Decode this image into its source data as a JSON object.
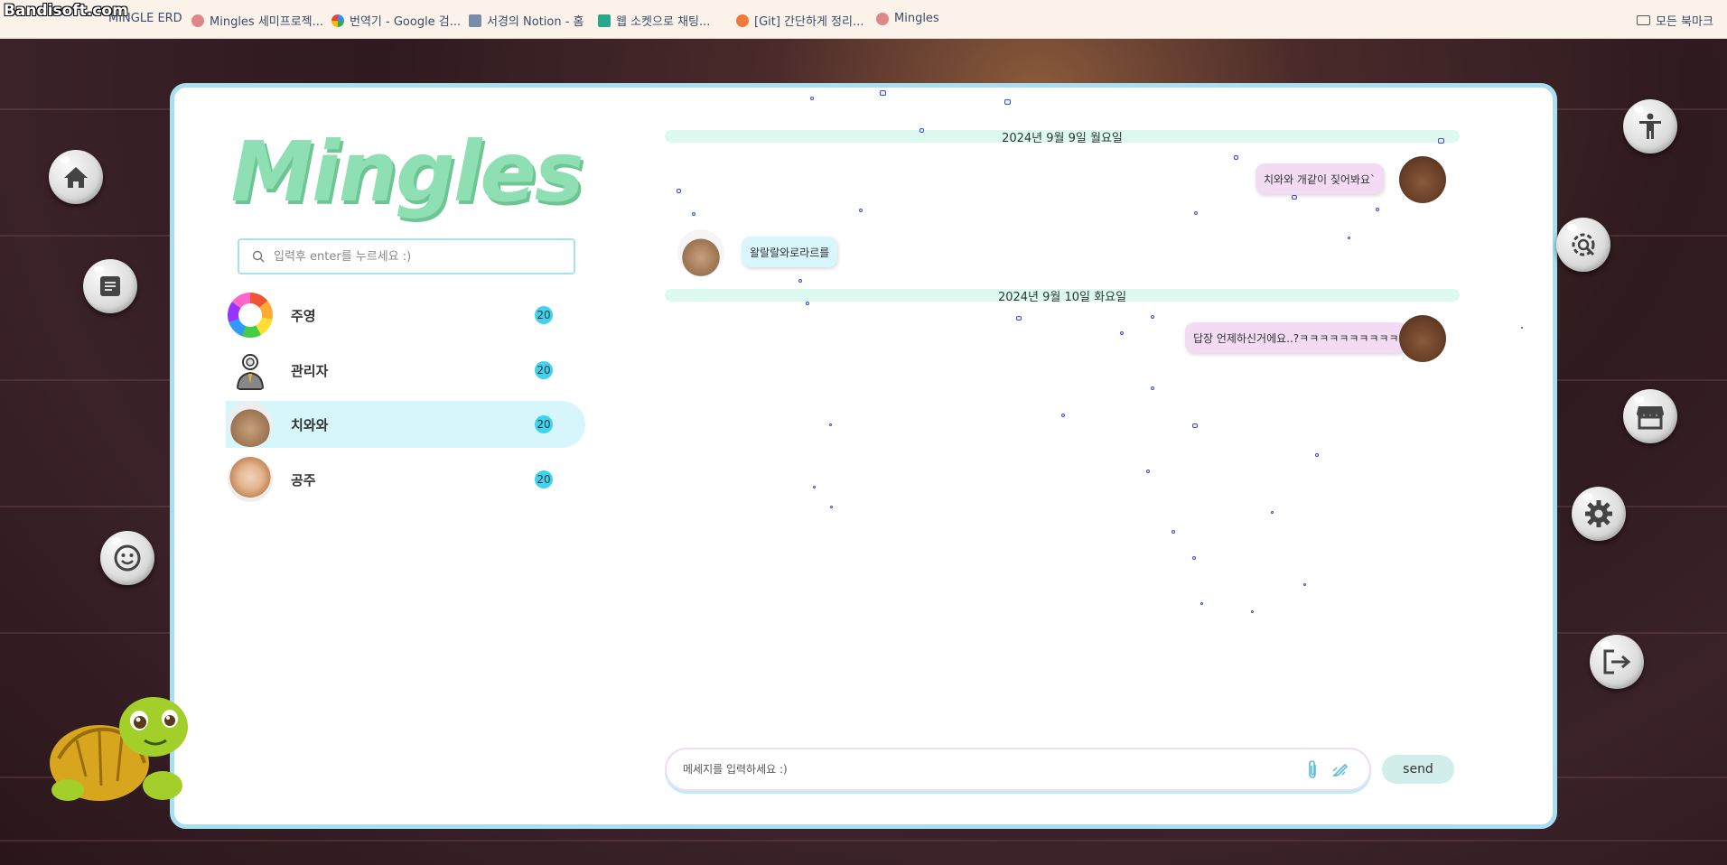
{
  "watermark": "Bandisoft.com",
  "bookmarks": {
    "items": [
      {
        "label": "MINGLE ERD"
      },
      {
        "label": "Mingles 세미프로젝..."
      },
      {
        "label": "번역기 - Google 검..."
      },
      {
        "label": "서경의 Notion - 홈"
      },
      {
        "label": "웹 소켓으로 채팅..."
      },
      {
        "label": "[Git] 간단하게 정리..."
      },
      {
        "label": "Mingles"
      }
    ],
    "all_bookmarks": "모든 북마크"
  },
  "app": {
    "logo": "Mingles",
    "search_placeholder": "입력후 enter를 누르세요 :)"
  },
  "friends": [
    {
      "name": "주영",
      "count": "20"
    },
    {
      "name": "관리자",
      "count": "20"
    },
    {
      "name": "치와와",
      "count": "20",
      "active": true
    },
    {
      "name": "공주",
      "count": "20"
    }
  ],
  "chat": {
    "dates": [
      "2024년 9월 9일 월요일",
      "2024년 9월 10일 화요일"
    ],
    "messages": [
      {
        "text": "치와와 개같이 짖어봐요`",
        "from": "me"
      },
      {
        "text": "왈랄랄와로라르를",
        "from": "other"
      },
      {
        "text": "답장 언제하신거에요..?ㅋㅋㅋㅋㅋㅋㅋㅋㅋㅋ",
        "from": "me"
      }
    ],
    "input_placeholder": "메세지를 입력하세요 :)",
    "send_label": "send"
  },
  "icons": {
    "left": [
      "home-icon",
      "document-icon",
      "emoji-icon"
    ],
    "right": [
      "accessibility-icon",
      "search-settings-icon",
      "store-icon",
      "settings-icon",
      "logout-icon"
    ]
  },
  "colors": {
    "card_border": "#a7dff0",
    "logo": "#8ee0b4",
    "active_row": "#d6f6fb",
    "badge": "#3ed3ef",
    "date_bar": "#dcfaf0",
    "my_bubble": "#f3dcf3",
    "other_bubble": "#d8f6fb"
  }
}
